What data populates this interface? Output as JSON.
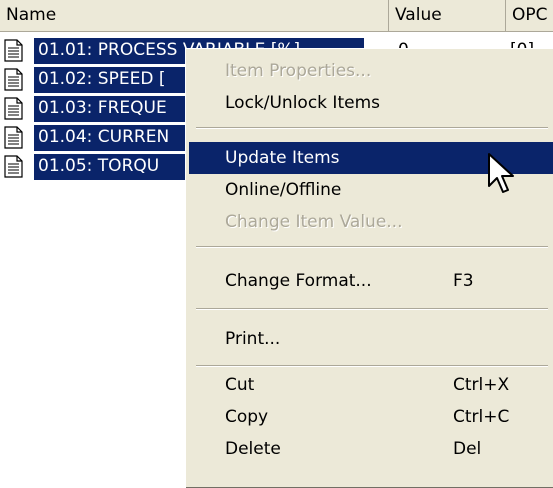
{
  "columns": {
    "name": "Name",
    "value": "Value",
    "opc": "OPC"
  },
  "rows": [
    {
      "label": "01.01: PROCESS VARIABLE [%]",
      "value": "0",
      "opc": "[0]"
    },
    {
      "label": "01.02: SPEED [",
      "value": "",
      "opc": ""
    },
    {
      "label": "01.03: FREQUE",
      "value": "",
      "opc": ""
    },
    {
      "label": "01.04: CURREN",
      "value": "",
      "opc": ""
    },
    {
      "label": "01.05: TORQU",
      "value": "",
      "opc": ""
    }
  ],
  "menu": {
    "item_properties": "Item Properties...",
    "lock_unlock": "Lock/Unlock Items",
    "update_items": "Update Items",
    "online_offline": "Online/Offline",
    "change_item_value": "Change Item Value...",
    "change_format": "Change Format...",
    "change_format_shortcut": "F3",
    "print": "Print...",
    "cut": "Cut",
    "cut_shortcut": "Ctrl+X",
    "copy": "Copy",
    "copy_shortcut": "Ctrl+C",
    "delete": "Delete",
    "delete_shortcut": "Del"
  },
  "colors": {
    "selection": "#0a246a",
    "menu_bg": "#ece9d8",
    "disabled_text": "#aca899"
  },
  "icons": {
    "row_icon": "document-icon",
    "cursor": "mouse-pointer-icon"
  }
}
